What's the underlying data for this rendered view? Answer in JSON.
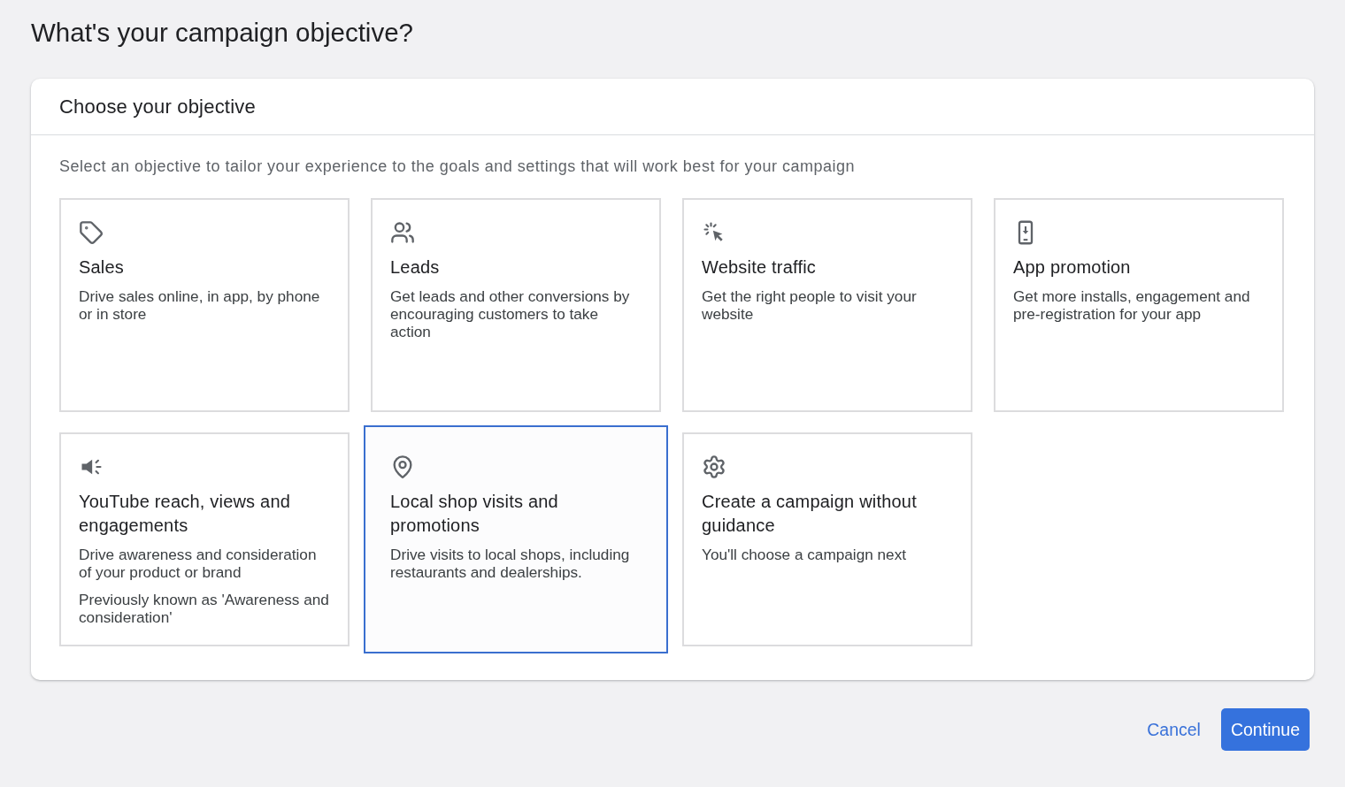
{
  "page_title": "What's your campaign objective?",
  "panel": {
    "title": "Choose your objective",
    "subtitle": "Select an objective to tailor your experience to the goals and settings that will work best for your campaign",
    "objectives": [
      {
        "title": "Sales",
        "descriptions": [
          "Drive sales online, in app, by phone or in store"
        ],
        "selected": false
      },
      {
        "title": "Leads",
        "descriptions": [
          "Get leads and other conversions by encouraging customers to take action"
        ],
        "selected": false
      },
      {
        "title": "Website traffic",
        "descriptions": [
          "Get the right people to visit your website"
        ],
        "selected": false
      },
      {
        "title": "App promotion",
        "descriptions": [
          "Get more installs, engagement and pre-registration for your app"
        ],
        "selected": false
      },
      {
        "title": "YouTube reach, views and engagements",
        "descriptions": [
          "Drive awareness and consideration of your product or brand",
          "Previously known as 'Awareness and consideration'"
        ],
        "selected": false
      },
      {
        "title": "Local shop visits and promotions",
        "descriptions": [
          "Drive visits to local shops, including restaurants and dealerships."
        ],
        "selected": true
      },
      {
        "title": "Create a campaign without guidance",
        "descriptions": [
          "You'll choose a campaign next"
        ],
        "selected": false
      }
    ]
  },
  "actions": {
    "cancel": "Cancel",
    "continue": "Continue"
  }
}
